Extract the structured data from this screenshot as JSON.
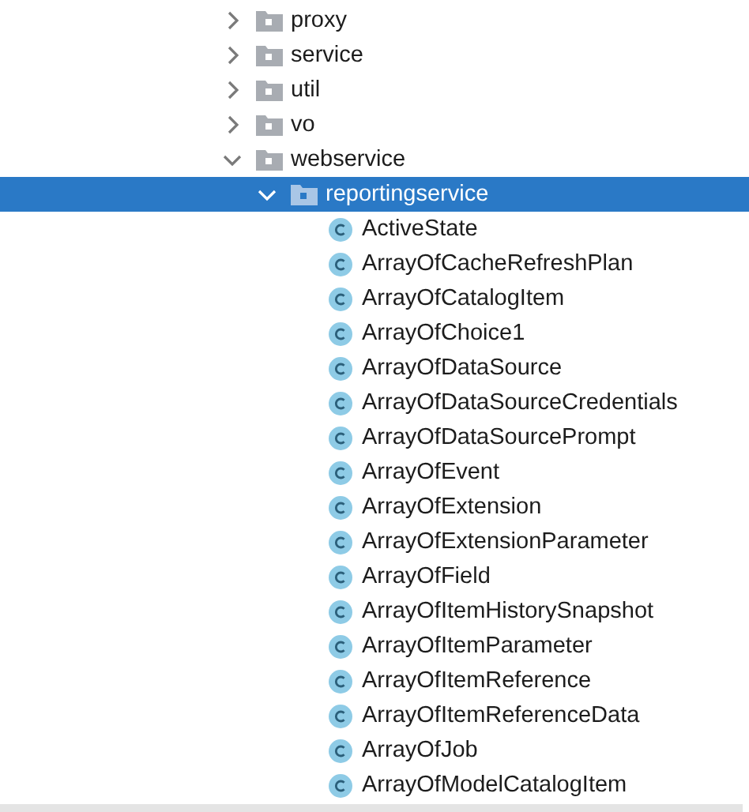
{
  "tree": [
    {
      "kind": "package",
      "label": "proxy",
      "expanded": false,
      "selected": false
    },
    {
      "kind": "package",
      "label": "service",
      "expanded": false,
      "selected": false
    },
    {
      "kind": "package",
      "label": "util",
      "expanded": false,
      "selected": false
    },
    {
      "kind": "package",
      "label": "vo",
      "expanded": false,
      "selected": false
    },
    {
      "kind": "package",
      "label": "webservice",
      "expanded": true,
      "selected": false,
      "children": [
        {
          "kind": "package",
          "label": "reportingservice",
          "expanded": true,
          "selected": true,
          "children": [
            {
              "kind": "class",
              "label": "ActiveState",
              "selected": false
            },
            {
              "kind": "class",
              "label": "ArrayOfCacheRefreshPlan",
              "selected": false
            },
            {
              "kind": "class",
              "label": "ArrayOfCatalogItem",
              "selected": false
            },
            {
              "kind": "class",
              "label": "ArrayOfChoice1",
              "selected": false
            },
            {
              "kind": "class",
              "label": "ArrayOfDataSource",
              "selected": false
            },
            {
              "kind": "class",
              "label": "ArrayOfDataSourceCredentials",
              "selected": false
            },
            {
              "kind": "class",
              "label": "ArrayOfDataSourcePrompt",
              "selected": false
            },
            {
              "kind": "class",
              "label": "ArrayOfEvent",
              "selected": false
            },
            {
              "kind": "class",
              "label": "ArrayOfExtension",
              "selected": false
            },
            {
              "kind": "class",
              "label": "ArrayOfExtensionParameter",
              "selected": false
            },
            {
              "kind": "class",
              "label": "ArrayOfField",
              "selected": false
            },
            {
              "kind": "class",
              "label": "ArrayOfItemHistorySnapshot",
              "selected": false
            },
            {
              "kind": "class",
              "label": "ArrayOfItemParameter",
              "selected": false
            },
            {
              "kind": "class",
              "label": "ArrayOfItemReference",
              "selected": false
            },
            {
              "kind": "class",
              "label": "ArrayOfItemReferenceData",
              "selected": false
            },
            {
              "kind": "class",
              "label": "ArrayOfJob",
              "selected": false
            },
            {
              "kind": "class",
              "label": "ArrayOfModelCatalogItem",
              "selected": false
            }
          ]
        }
      ]
    }
  ]
}
